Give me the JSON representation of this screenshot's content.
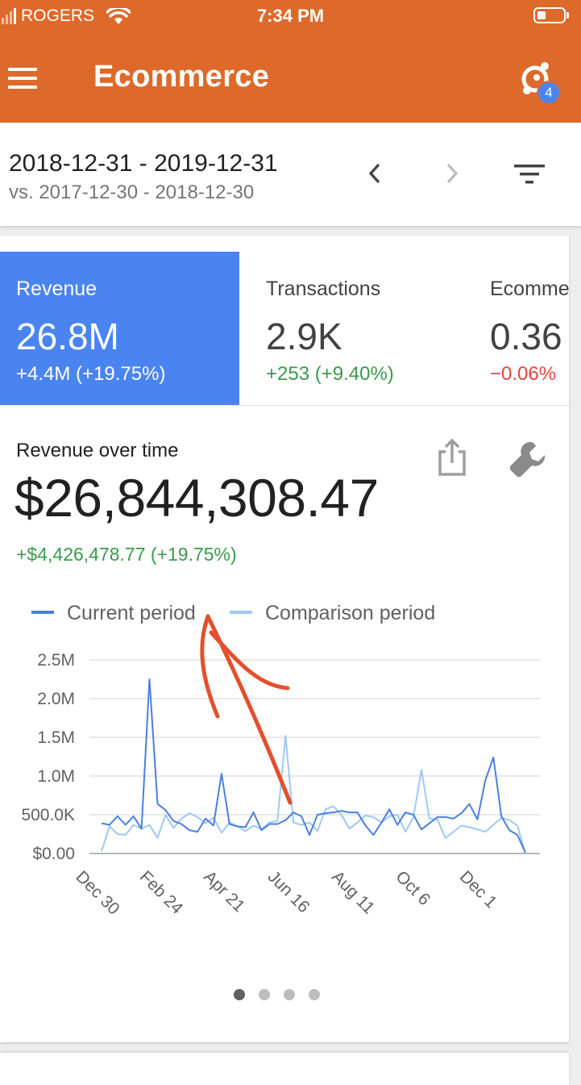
{
  "status_bar": {
    "carrier": "ROGERS",
    "time": "7:34 PM",
    "icons": [
      "signal-icon",
      "wifi-icon",
      "battery-icon"
    ]
  },
  "app_bar": {
    "title": "Ecommerce",
    "menu_icon": "menu-icon",
    "insights_icon": "insights-icon",
    "insights_badge": "4"
  },
  "date_bar": {
    "range": "2018-12-31 - 2019-12-31",
    "compare": "vs. 2017-12-30 - 2018-12-30",
    "prev_icon": "chevron-left-icon",
    "next_icon": "chevron-right-icon",
    "filter_icon": "filter-icon"
  },
  "metrics": [
    {
      "label": "Revenue",
      "value": "26.8M",
      "delta": "+4.4M (+19.75%)",
      "trend": "up"
    },
    {
      "label": "Transactions",
      "value": "2.9K",
      "delta": "+253 (+9.40%)",
      "trend": "up"
    },
    {
      "label": "Ecomme",
      "value": "0.36",
      "delta": "−0.06%",
      "trend": "down"
    }
  ],
  "card": {
    "title": "Revenue over time",
    "total": "$26,844,308.47",
    "change": "+$4,426,478.77 (+19.75%)",
    "share_icon": "share-icon",
    "customize_icon": "wrench-icon"
  },
  "pager": {
    "count": 4,
    "active": 0
  },
  "colors": {
    "app_bar": "#dd6a2b",
    "selected_metric": "#4a84f1",
    "current_series": "#4a7fe0",
    "comparison_series": "#9ec9f5",
    "positive": "#3a9a4b",
    "negative": "#e0473e",
    "annotation": "#e2502d"
  },
  "chart_data": {
    "type": "line",
    "title": "",
    "xlabel": "",
    "ylabel": "",
    "ylim": [
      0,
      2500000
    ],
    "y_ticks": [
      "$0.00",
      "500.0K",
      "1.0M",
      "1.5M",
      "2.0M",
      "2.5M"
    ],
    "x_ticks": [
      "Dec 30",
      "Feb 24",
      "Apr 21",
      "Jun 16",
      "Aug 11",
      "Oct 6",
      "Dec 1"
    ],
    "legend_position": "top-left",
    "grid": true,
    "weeks": 54,
    "series": [
      {
        "name": "Current period",
        "color": "#4a7fe0",
        "values": [
          390000,
          370000,
          480000,
          370000,
          480000,
          320000,
          2250000,
          640000,
          560000,
          420000,
          380000,
          300000,
          280000,
          450000,
          360000,
          1030000,
          380000,
          350000,
          340000,
          530000,
          300000,
          380000,
          380000,
          430000,
          530000,
          480000,
          240000,
          500000,
          520000,
          530000,
          550000,
          530000,
          530000,
          360000,
          240000,
          400000,
          570000,
          370000,
          530000,
          500000,
          310000,
          390000,
          470000,
          470000,
          450000,
          520000,
          640000,
          440000,
          950000,
          1240000,
          480000,
          300000,
          240000,
          10000
        ]
      },
      {
        "name": "Comparison period",
        "color": "#9ec9f5",
        "values": [
          30000,
          350000,
          250000,
          240000,
          370000,
          320000,
          370000,
          200000,
          500000,
          330000,
          450000,
          520000,
          470000,
          390000,
          460000,
          270000,
          400000,
          350000,
          290000,
          360000,
          310000,
          400000,
          420000,
          1520000,
          400000,
          370000,
          400000,
          290000,
          570000,
          610000,
          500000,
          320000,
          400000,
          490000,
          470000,
          400000,
          480000,
          500000,
          280000,
          470000,
          1080000,
          450000,
          440000,
          200000,
          280000,
          360000,
          340000,
          310000,
          280000,
          370000,
          460000,
          430000,
          360000,
          0
        ]
      }
    ]
  }
}
